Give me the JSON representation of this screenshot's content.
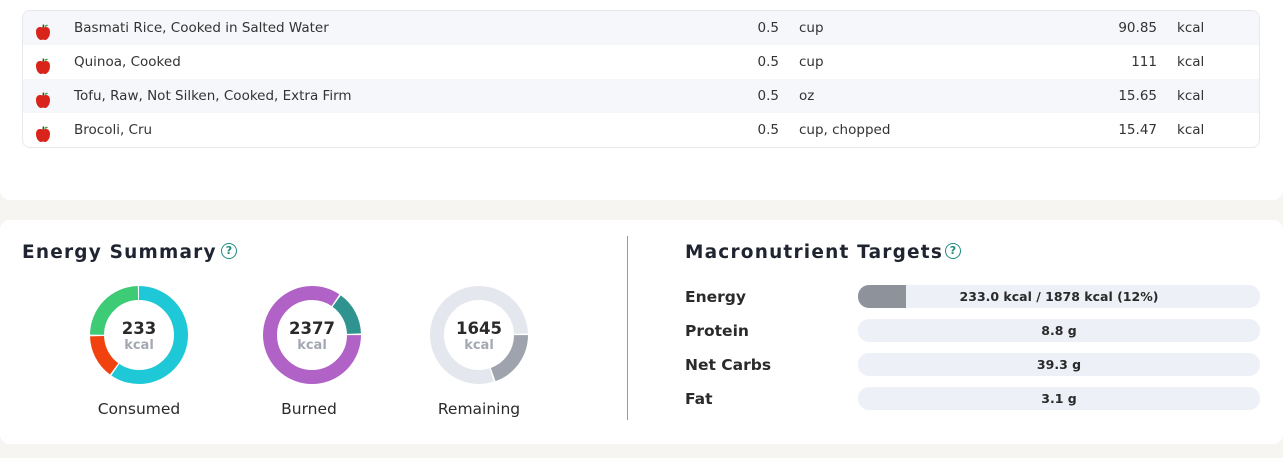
{
  "foods": [
    {
      "name": "Basmati Rice, Cooked in Salted Water",
      "qty": "0.5",
      "unit": "cup",
      "calories": "90.85",
      "cal_unit": "kcal"
    },
    {
      "name": "Quinoa, Cooked",
      "qty": "0.5",
      "unit": "cup",
      "calories": "111",
      "cal_unit": "kcal"
    },
    {
      "name": "Tofu, Raw, Not Silken, Cooked, Extra Firm",
      "qty": "0.5",
      "unit": "oz",
      "calories": "15.65",
      "cal_unit": "kcal"
    },
    {
      "name": "Brocoli, Cru",
      "qty": "0.5",
      "unit": "cup, chopped",
      "calories": "15.47",
      "cal_unit": "kcal"
    }
  ],
  "energy_summary": {
    "title": "Energy Summary",
    "help_icon": "question-circle-icon",
    "donuts": [
      {
        "value": "233",
        "unit": "kcal",
        "label": "Consumed",
        "segments": [
          {
            "fraction": 0.6,
            "color": "#1fc8d6"
          },
          {
            "fraction": 0.15,
            "color": "#f0410f"
          },
          {
            "fraction": 0.25,
            "color": "#3ecb76"
          }
        ]
      },
      {
        "value": "2377",
        "unit": "kcal",
        "label": "Burned",
        "segments": [
          {
            "fraction": 0.15,
            "color": "#2f9490"
          },
          {
            "fraction": 0.85,
            "color": "#b062c7"
          }
        ],
        "start_fraction": 0.1
      },
      {
        "value": "1645",
        "unit": "kcal",
        "label": "Remaining",
        "segments": [
          {
            "fraction": 0.2,
            "color": "#9ea3ad"
          },
          {
            "fraction": 0.8,
            "color": "#e4e7ee"
          }
        ],
        "start_fraction": 0.25
      }
    ]
  },
  "macronutrient_targets": {
    "title": "Macronutrient Targets",
    "help_icon": "question-circle-icon",
    "rows": [
      {
        "label": "Energy",
        "text": "233.0 kcal / 1878 kcal (12%)",
        "fill_fraction": 0.12
      },
      {
        "label": "Protein",
        "text": "8.8 g",
        "fill_fraction": 0
      },
      {
        "label": "Net Carbs",
        "text": "39.3 g",
        "fill_fraction": 0
      },
      {
        "label": "Fat",
        "text": "3.1 g",
        "fill_fraction": 0
      }
    ]
  },
  "colors": {
    "accent": "#1f8a80",
    "apple": "#d9241b"
  }
}
